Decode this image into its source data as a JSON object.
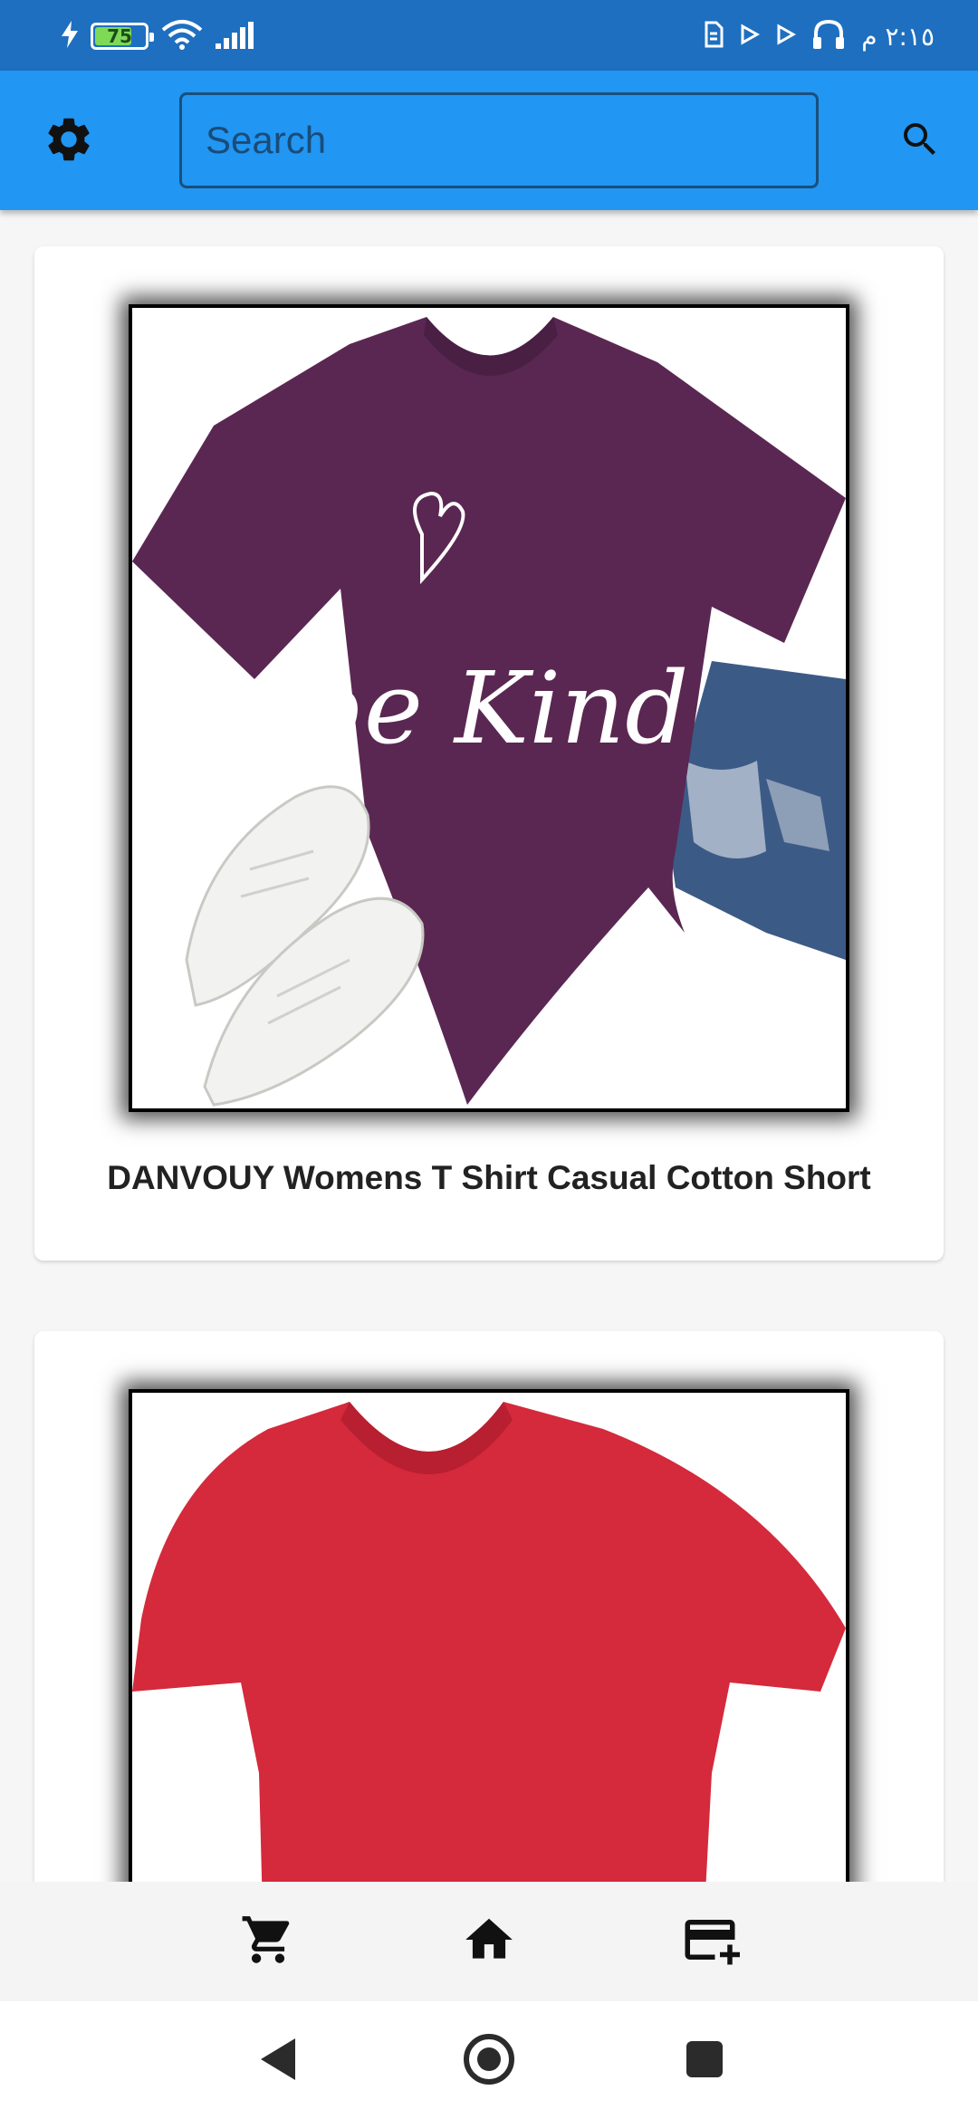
{
  "status_bar": {
    "battery_level": 75,
    "battery_text": "75",
    "time": "٢:١٥ م",
    "icons": [
      "charging-bolt-icon",
      "battery-icon",
      "wifi-icon",
      "signal-icon",
      "sim-icon",
      "play-icon",
      "play-icon",
      "headphones-icon"
    ]
  },
  "app_bar": {
    "settings_icon": "gear-icon",
    "search_placeholder": "Search",
    "search_value": "",
    "search_icon": "search-icon",
    "color": "#2196f3"
  },
  "products": [
    {
      "title": "DANVOUY Womens T Shirt Casual Cotton Short",
      "image_text": "be Kind",
      "image_color": "#5a2752"
    },
    {
      "title": "",
      "image_color": "#d42a3c"
    }
  ],
  "bottom_nav": {
    "items": [
      "cart-icon",
      "home-icon",
      "add-card-icon"
    ]
  },
  "system_nav": {
    "items": [
      "back-icon",
      "home-circle-icon",
      "recents-icon"
    ]
  }
}
